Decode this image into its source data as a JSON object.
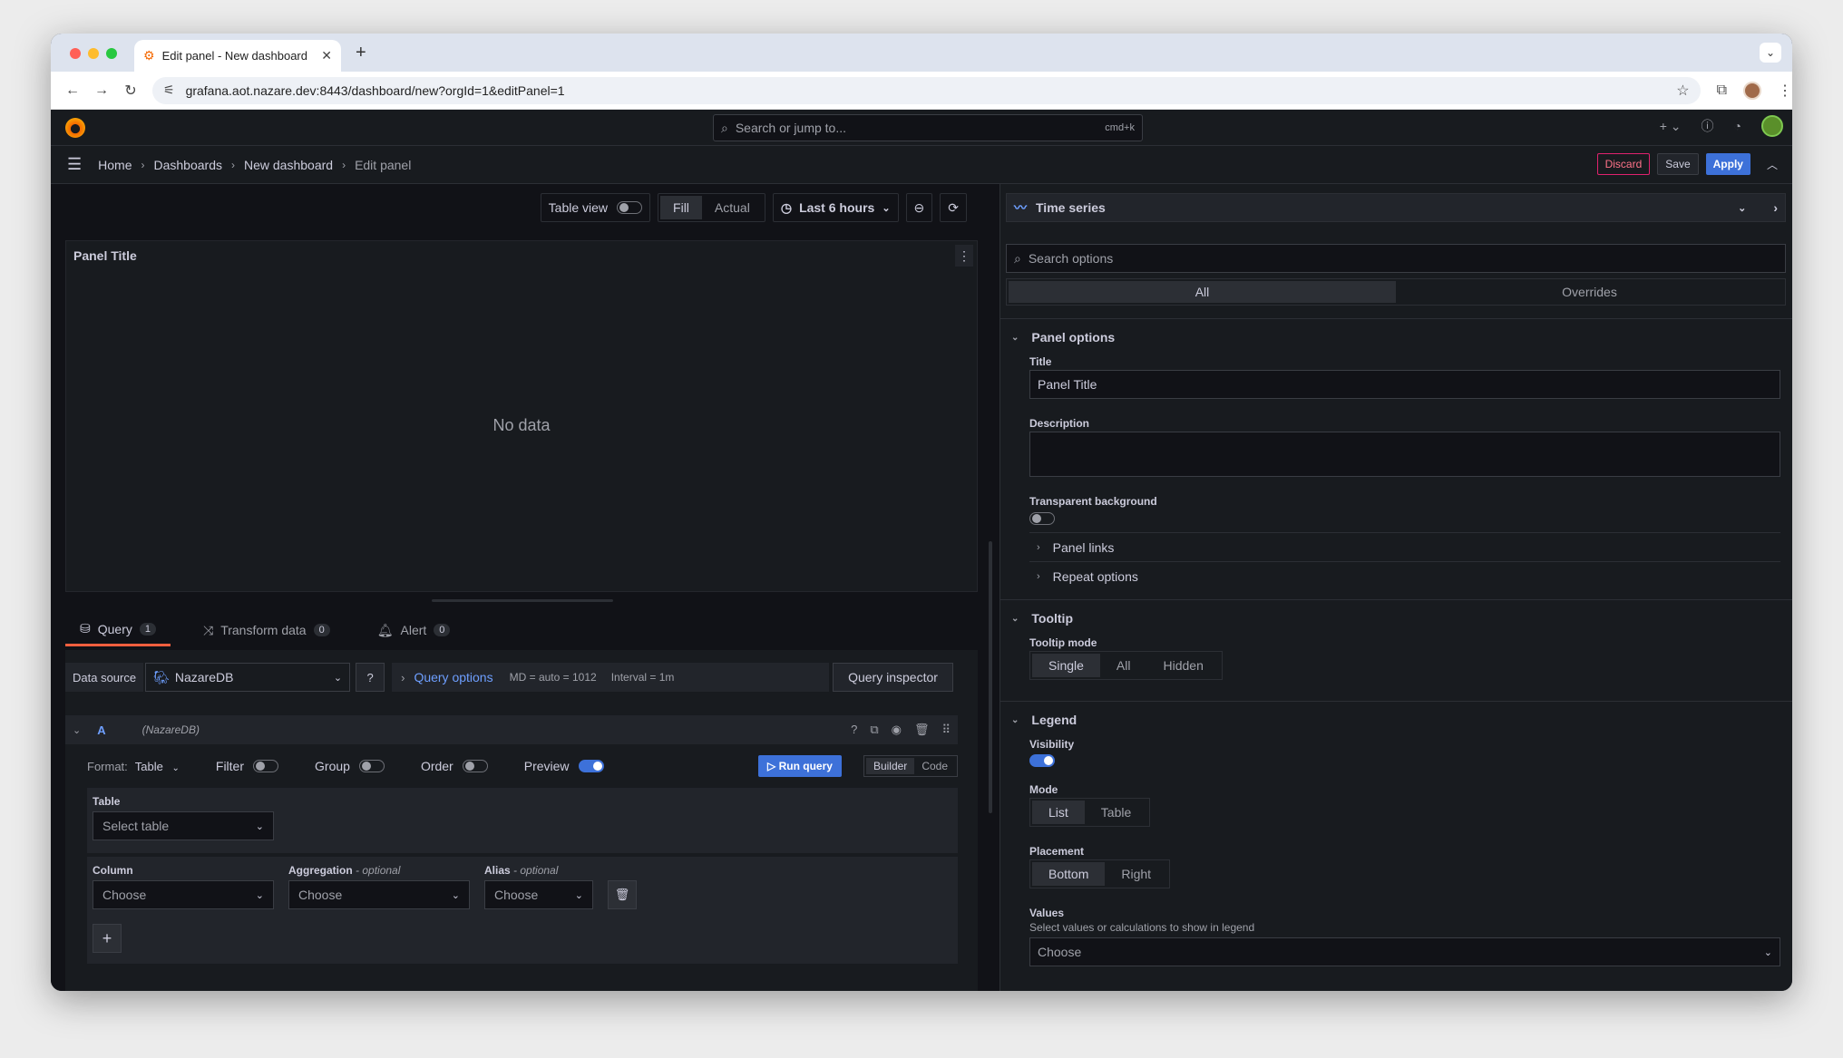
{
  "browser": {
    "tab_title": "Edit panel - New dashboard",
    "url": "grafana.aot.nazare.dev:8443/dashboard/new?orgId=1&editPanel=1"
  },
  "topbar": {
    "search_placeholder": "Search or jump to...",
    "search_shortcut": "cmd+k",
    "add_label": "+"
  },
  "breadcrumb": {
    "home": "Home",
    "dashboards": "Dashboards",
    "new_dashboard": "New dashboard",
    "current": "Edit panel"
  },
  "actions": {
    "discard": "Discard",
    "save": "Save",
    "apply": "Apply"
  },
  "toolbar": {
    "table_view": "Table view",
    "fill": "Fill",
    "actual": "Actual",
    "time_range": "Last 6 hours"
  },
  "panel": {
    "title": "Panel Title",
    "empty_message": "No data"
  },
  "query_tabs": [
    {
      "label": "Query",
      "count": "1"
    },
    {
      "label": "Transform data",
      "count": "0"
    },
    {
      "label": "Alert",
      "count": "0"
    }
  ],
  "datasource": {
    "label": "Data source",
    "selected": "NazareDB",
    "query_options_label": "Query options",
    "md": "MD = auto = 1012",
    "interval": "Interval = 1m",
    "inspector": "Query inspector"
  },
  "query": {
    "ref_id": "A",
    "ds_name": "(NazareDB)",
    "format_label": "Format:",
    "format_value": "Table",
    "filter": "Filter",
    "group": "Group",
    "order": "Order",
    "preview": "Preview",
    "run": "Run query",
    "builder": "Builder",
    "code": "Code",
    "table_label": "Table",
    "table_placeholder": "Select table",
    "column_label": "Column",
    "aggregation_label": "Aggregation",
    "alias_label": "Alias",
    "optional": "- optional",
    "choose": "Choose"
  },
  "options": {
    "viz": "Time series",
    "search_placeholder": "Search options",
    "tab_all": "All",
    "tab_overrides": "Overrides",
    "panel_options": "Panel options",
    "title_label": "Title",
    "title_value": "Panel Title",
    "description_label": "Description",
    "transparent_label": "Transparent background",
    "panel_links": "Panel links",
    "repeat_options": "Repeat options",
    "tooltip": "Tooltip",
    "tooltip_mode_label": "Tooltip mode",
    "tooltip_modes": [
      "Single",
      "All",
      "Hidden"
    ],
    "legend": "Legend",
    "visibility_label": "Visibility",
    "mode_label": "Mode",
    "modes": [
      "List",
      "Table"
    ],
    "placement_label": "Placement",
    "placements": [
      "Bottom",
      "Right"
    ],
    "values_label": "Values",
    "values_desc": "Select values or calculations to show in legend",
    "values_placeholder": "Choose"
  },
  "colors": {
    "accent": "#3d71d9",
    "danger": "#e0226e",
    "tab_underline": "#f55f3e"
  }
}
